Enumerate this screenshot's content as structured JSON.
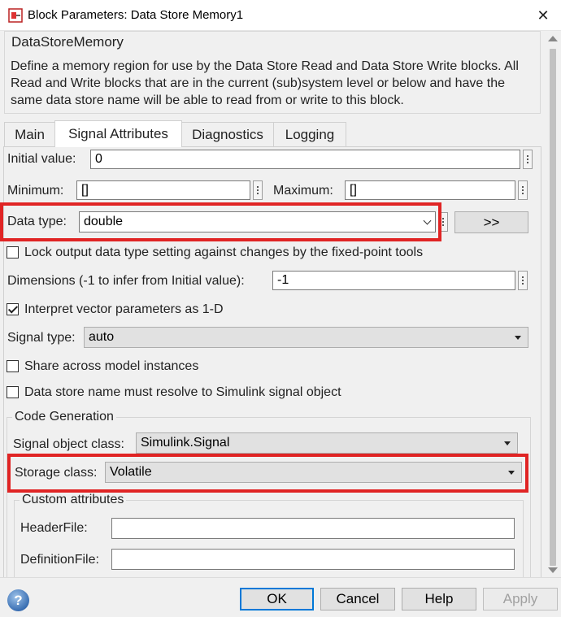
{
  "window": {
    "title": "Block Parameters: Data Store Memory1",
    "close_glyph": "✕"
  },
  "description": {
    "heading": "DataStoreMemory",
    "text": "Define a memory region for use by the Data Store Read and Data Store Write blocks. All Read and Write blocks that are in the current (sub)system level or below and have the same data store name will be able to read from or write to this block."
  },
  "tabs": [
    {
      "label": "Main",
      "active": false
    },
    {
      "label": "Signal Attributes",
      "active": true
    },
    {
      "label": "Diagnostics",
      "active": false
    },
    {
      "label": "Logging",
      "active": false
    }
  ],
  "signal_attributes": {
    "initial_value_label": "Initial value:",
    "initial_value": "0",
    "minimum_label": "Minimum:",
    "minimum": "[]",
    "maximum_label": "Maximum:",
    "maximum": "[]",
    "data_type_label": "Data type:",
    "data_type": "double",
    "data_type_assistant": ">>",
    "lock_label": "Lock output data type setting against changes by the fixed-point tools",
    "lock_checked": false,
    "dimensions_label": "Dimensions (-1 to infer from Initial value):",
    "dimensions": "-1",
    "interpret_label": "Interpret vector parameters as 1-D",
    "interpret_checked": true,
    "signal_type_label": "Signal type:",
    "signal_type": "auto",
    "share_label": "Share across model instances",
    "share_checked": false,
    "resolve_label": "Data store name must resolve to Simulink signal object",
    "resolve_checked": false
  },
  "code_generation": {
    "title": "Code Generation",
    "signal_object_class_label": "Signal object class:",
    "signal_object_class": "Simulink.Signal",
    "storage_class_label": "Storage class:",
    "storage_class": "Volatile",
    "custom_attributes_title": "Custom attributes",
    "header_file_label": "HeaderFile:",
    "header_file": "",
    "definition_file_label": "DefinitionFile:",
    "definition_file": ""
  },
  "footer": {
    "help_glyph": "?",
    "ok": "OK",
    "cancel": "Cancel",
    "help": "Help",
    "apply": "Apply"
  },
  "colors": {
    "highlight": "#e02424",
    "default_button_border": "#0078d7"
  }
}
